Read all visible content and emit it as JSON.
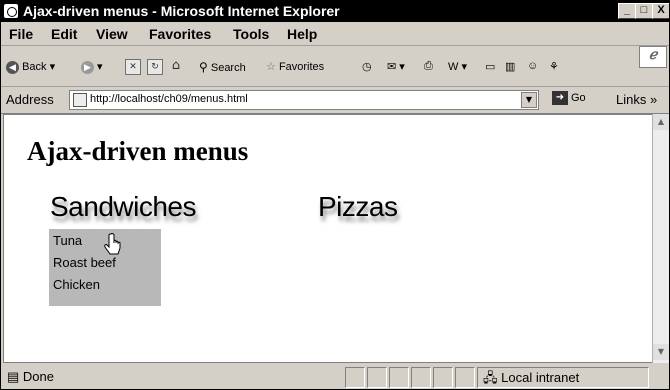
{
  "window": {
    "title": "Ajax-driven menus - Microsoft Internet Explorer",
    "minimize": "_",
    "maximize": "□",
    "close": "X"
  },
  "menubar": {
    "items": [
      "File",
      "Edit",
      "View",
      "Favorites",
      "Tools",
      "Help"
    ]
  },
  "toolbar": {
    "back": "Back",
    "search": "Search",
    "favorites": "Favorites"
  },
  "address": {
    "label": "Address",
    "url": "http://localhost/ch09/menus.html",
    "go": "Go",
    "links": "Links"
  },
  "page": {
    "heading": "Ajax-driven menus",
    "menus": [
      {
        "label": "Sandwiches",
        "items": [
          "Tuna",
          "Roast beef",
          "Chicken"
        ]
      },
      {
        "label": "Pizzas"
      }
    ]
  },
  "status": {
    "text": "Done",
    "zone": "Local intranet"
  },
  "icons": [
    "ie-icon",
    "back-icon",
    "forward-icon",
    "stop-icon",
    "refresh-icon",
    "home-icon",
    "search-icon",
    "favorites-icon",
    "history-icon",
    "mail-icon",
    "print-icon",
    "edit-icon",
    "discuss-icon",
    "messenger-icon",
    "page-icon",
    "go-icon",
    "hand-cursor-icon"
  ]
}
